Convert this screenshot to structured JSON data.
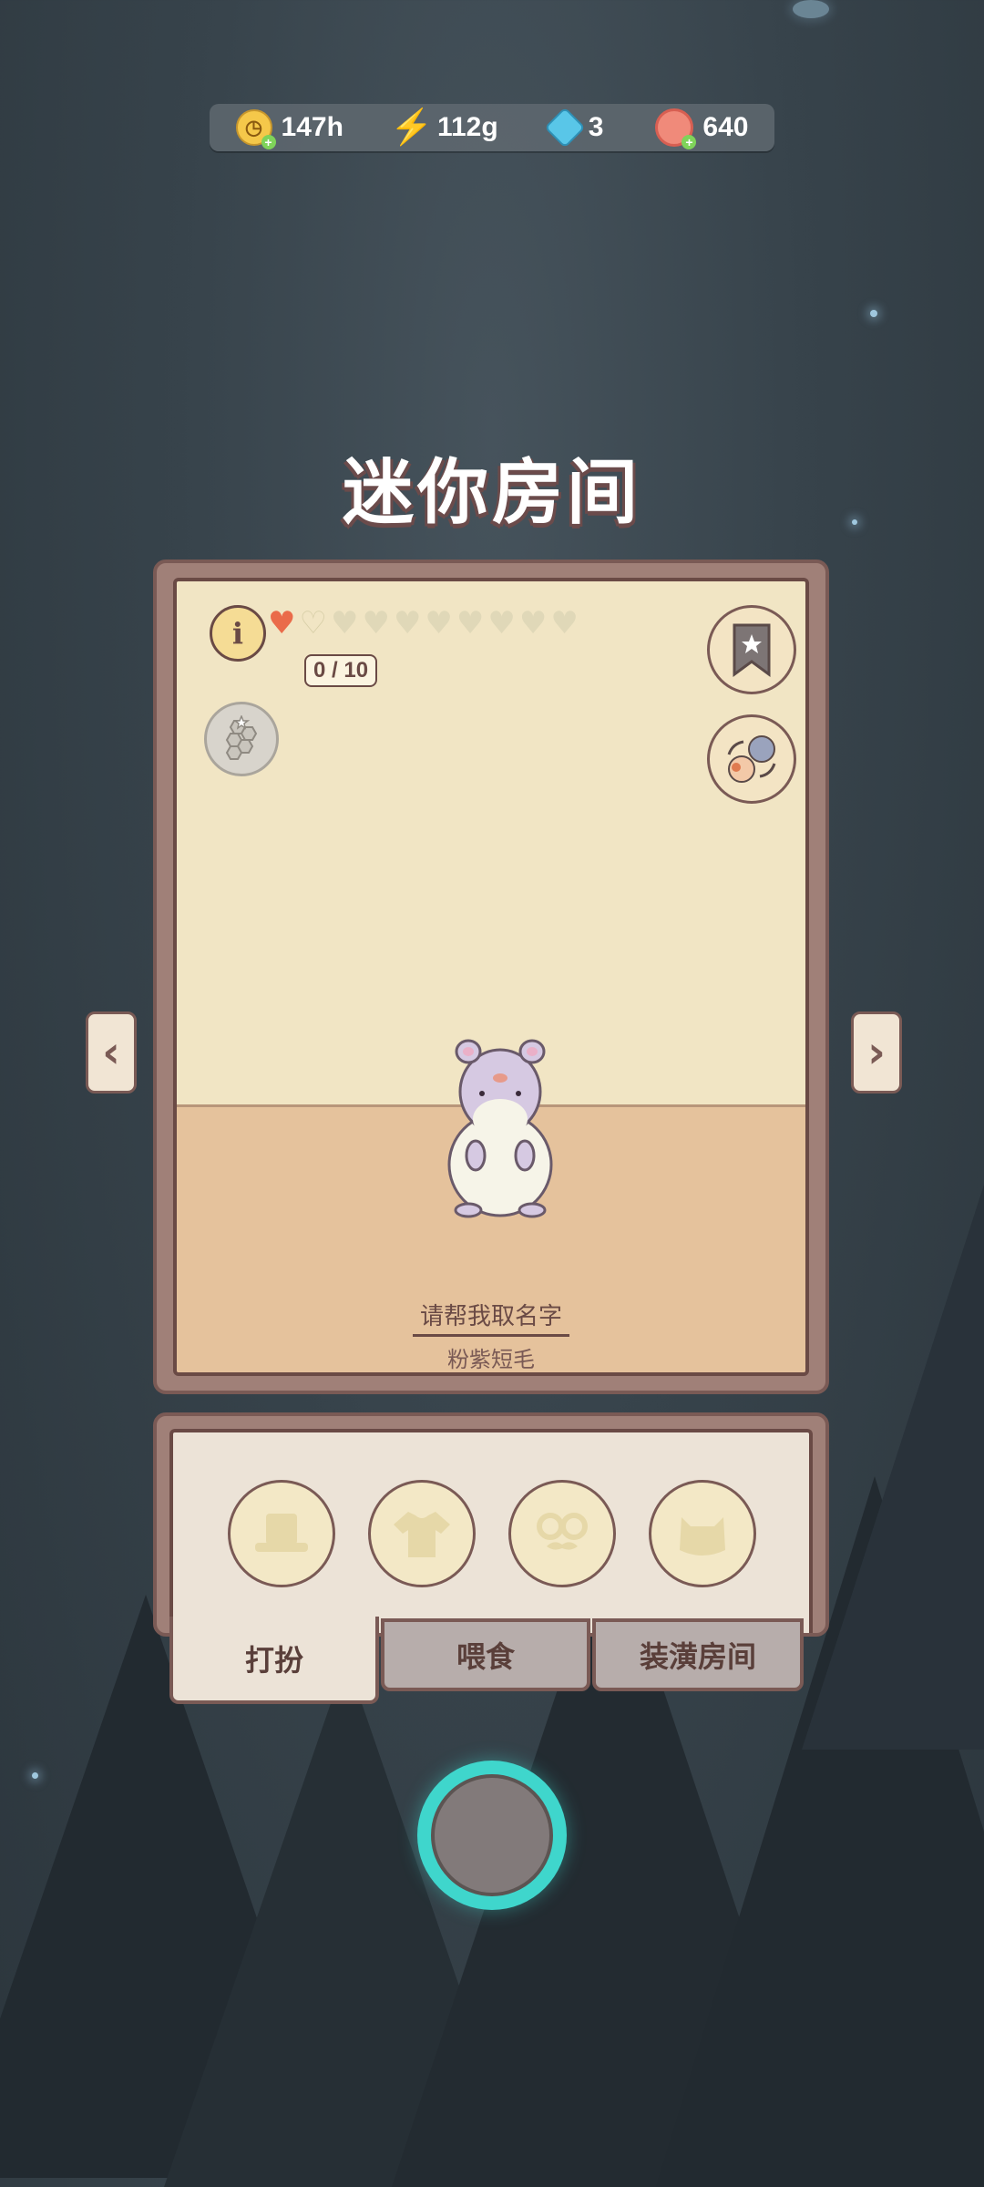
{
  "resources": [
    {
      "id": "time",
      "value": "147h",
      "icon": "coin-clock-icon"
    },
    {
      "id": "energy",
      "value": "112g",
      "icon": "energy-bolt-icon"
    },
    {
      "id": "gems",
      "value": "3",
      "icon": "gem-icon"
    },
    {
      "id": "donut",
      "value": "640",
      "icon": "donut-icon"
    }
  ],
  "title": "迷你房间",
  "room": {
    "hearts_filled": 1,
    "hearts_total": 10,
    "heart_count": "0 / 10",
    "pet_name": "请帮我取名字",
    "pet_breed": "粉紫短毛",
    "colors": {
      "wall": "#f1e5c4",
      "floor": "#e5c29c",
      "heart": "#ea6b4a"
    }
  },
  "slots": [
    {
      "icon": "hat-icon"
    },
    {
      "icon": "shirt-icon"
    },
    {
      "icon": "glasses-icon"
    },
    {
      "icon": "pet-face-icon"
    }
  ],
  "tabs": [
    {
      "label": "打扮",
      "active": true
    },
    {
      "label": "喂食",
      "active": false
    },
    {
      "label": "装潢房间",
      "active": false
    }
  ],
  "accent_color": "#3fd6cc"
}
